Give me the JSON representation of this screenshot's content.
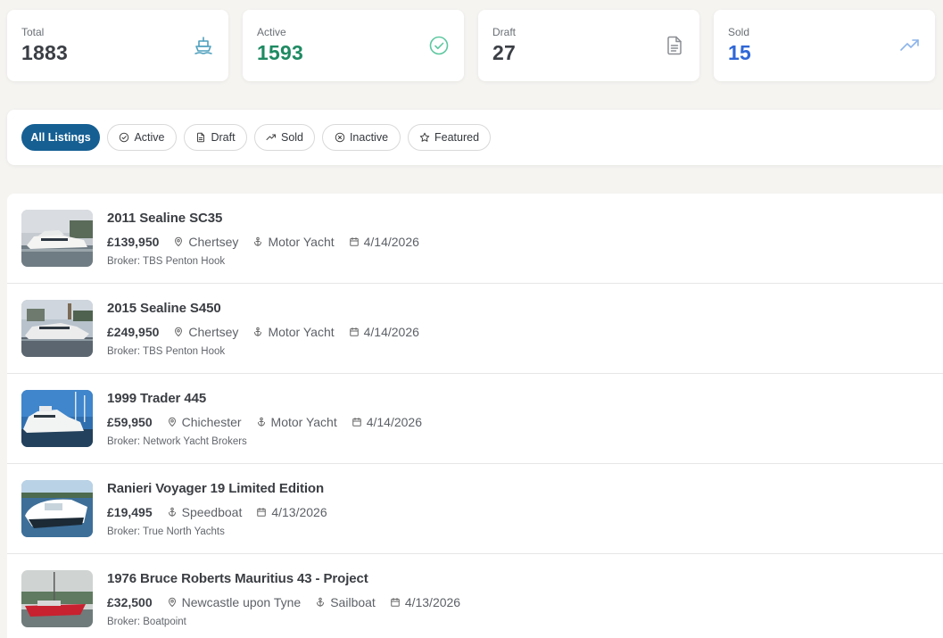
{
  "stats": [
    {
      "label": "Total",
      "value": "1883",
      "icon": "yacht-icon"
    },
    {
      "label": "Active",
      "value": "1593",
      "icon": "check-circle-icon"
    },
    {
      "label": "Draft",
      "value": "27",
      "icon": "document-icon"
    },
    {
      "label": "Sold",
      "value": "15",
      "icon": "trending-up-icon"
    }
  ],
  "filters": [
    {
      "label": "All Listings",
      "active": true
    },
    {
      "label": "Active",
      "icon": "check-circle-icon"
    },
    {
      "label": "Draft",
      "icon": "document-icon"
    },
    {
      "label": "Sold",
      "icon": "trending-up-icon"
    },
    {
      "label": "Inactive",
      "icon": "x-circle-icon"
    },
    {
      "label": "Featured",
      "icon": "star-icon"
    }
  ],
  "listings": [
    {
      "title": "2011 Sealine SC35",
      "price": "£139,950",
      "location": "Chertsey",
      "type": "Motor Yacht",
      "date": "4/14/2026",
      "broker": "Broker: TBS Penton Hook"
    },
    {
      "title": "2015 Sealine S450",
      "price": "£249,950",
      "location": "Chertsey",
      "type": "Motor Yacht",
      "date": "4/14/2026",
      "broker": "Broker: TBS Penton Hook"
    },
    {
      "title": "1999 Trader 445",
      "price": "£59,950",
      "location": "Chichester",
      "type": "Motor Yacht",
      "date": "4/14/2026",
      "broker": "Broker: Network Yacht Brokers"
    },
    {
      "title": "Ranieri Voyager 19 Limited Edition",
      "price": "£19,495",
      "type": "Speedboat",
      "date": "4/13/2026",
      "broker": "Broker: True North Yachts"
    },
    {
      "title": "1976 Bruce Roberts Mauritius 43 - Project",
      "price": "£32,500",
      "location": "Newcastle upon Tyne",
      "type": "Sailboat",
      "date": "4/13/2026",
      "broker": "Broker: Boatpoint"
    }
  ],
  "colors": {
    "accent": "#155f93",
    "active_green": "#1f8a63",
    "sold_blue": "#2f67d6"
  }
}
